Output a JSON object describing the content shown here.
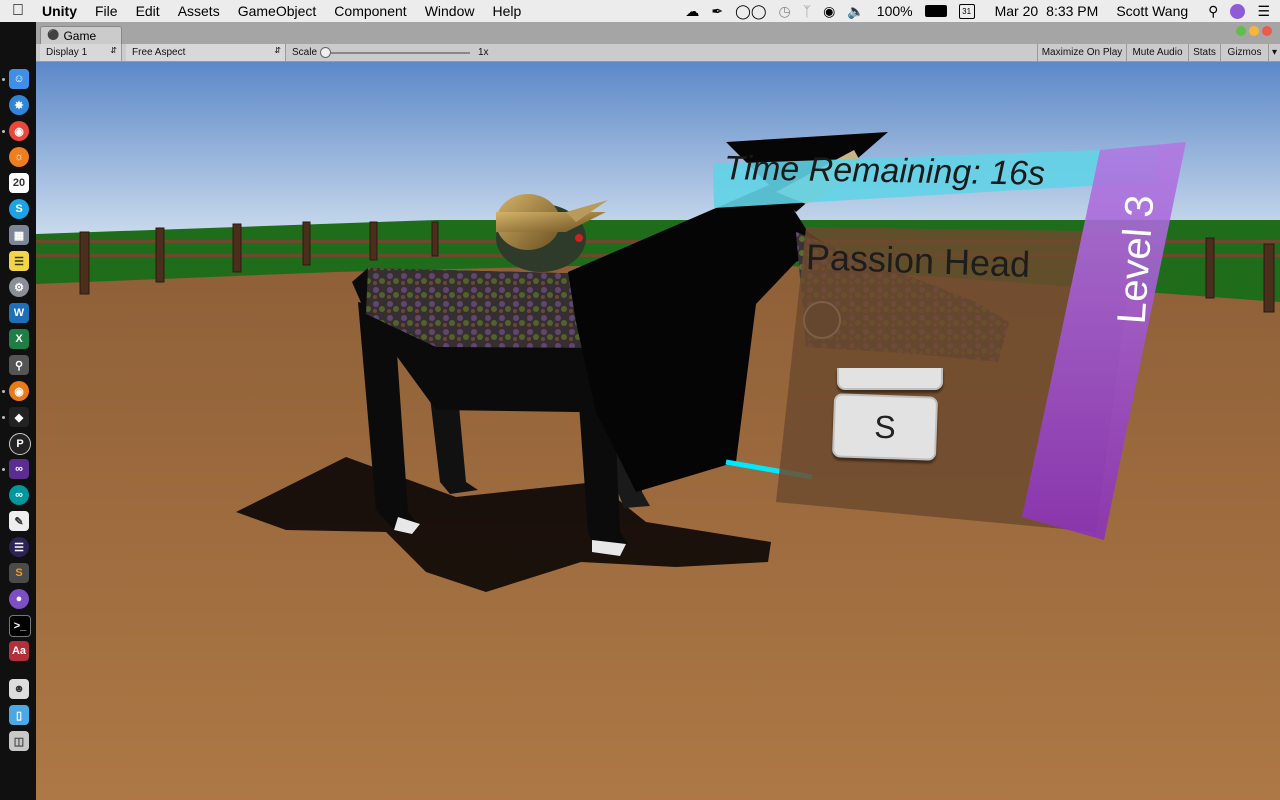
{
  "menubar": {
    "app_name": "Unity",
    "menus": [
      "File",
      "Edit",
      "Assets",
      "GameObject",
      "Component",
      "Window",
      "Help"
    ],
    "battery": "100%",
    "calendar_icon": "31",
    "date": "Mar 20",
    "time": "8:33 PM",
    "user": "Scott Wang"
  },
  "dock": {
    "calendar_date": "20"
  },
  "window": {
    "tab_title": "Game"
  },
  "toolbar": {
    "display": "Display 1",
    "aspect": "Free Aspect",
    "scale_label": "Scale",
    "scale_value": "1x",
    "maximize_on_play": "Maximize On Play",
    "mute_audio": "Mute Audio",
    "stats": "Stats",
    "gizmos": "Gizmos"
  },
  "game_ui": {
    "timer_text": "Time Remaining: 16s",
    "objective_text": "Passion Head",
    "level_text": "Level 3",
    "key_hint": "S"
  },
  "colors": {
    "sky_top": "#5c88c8",
    "sky_bottom": "#dbe7f2",
    "grass": "#1f6d1b",
    "ground": "#a67242",
    "timer_panel": "#62d3e6",
    "level_panel": "#9c4fc4",
    "cyan_line": "#00e7ff"
  }
}
